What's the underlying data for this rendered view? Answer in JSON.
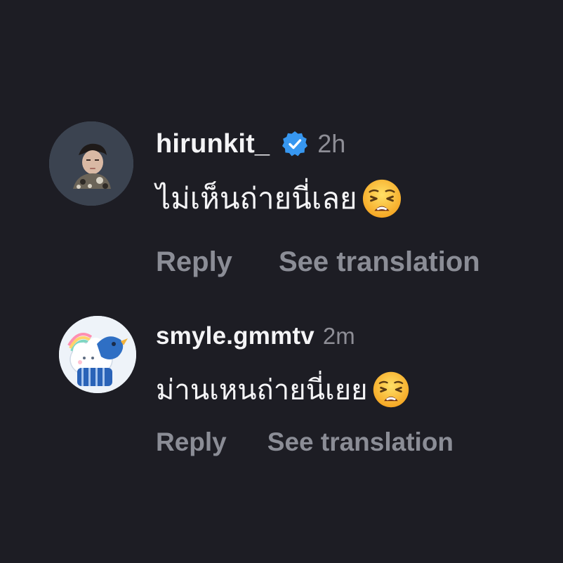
{
  "comments": [
    {
      "username": "hirunkit_",
      "verified": true,
      "time": "2h",
      "text": "ไม่เห็นถ่ายนี่เลย",
      "emoji": "weary-face",
      "reply_label": "Reply",
      "translate_label": "See translation"
    },
    {
      "username": "smyle.gmmtv",
      "verified": false,
      "time": "2m",
      "text": "ม่านเหนถ่ายนี่เยย",
      "emoji": "weary-face",
      "reply_label": "Reply",
      "translate_label": "See translation"
    }
  ],
  "colors": {
    "background": "#1d1d24",
    "primary_text": "#f4f4f6",
    "secondary_text": "#8e8e96",
    "verified_badge": "#3797f0"
  }
}
